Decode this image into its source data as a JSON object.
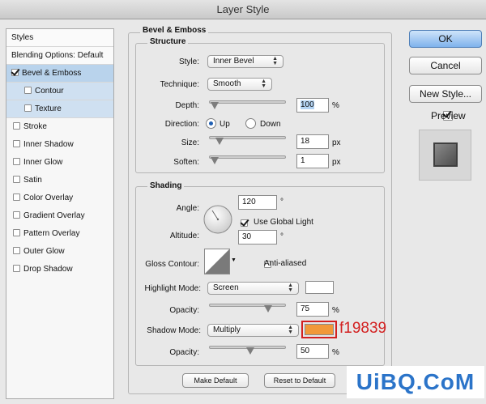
{
  "window": {
    "title": "Layer Style"
  },
  "styles_list": {
    "header": "Styles",
    "blending": "Blending Options: Default",
    "items": [
      {
        "label": "Bevel & Emboss",
        "checked": true
      },
      {
        "label": "Contour",
        "checked": false
      },
      {
        "label": "Texture",
        "checked": false
      },
      {
        "label": "Stroke",
        "checked": false
      },
      {
        "label": "Inner Shadow",
        "checked": false
      },
      {
        "label": "Inner Glow",
        "checked": false
      },
      {
        "label": "Satin",
        "checked": false
      },
      {
        "label": "Color Overlay",
        "checked": false
      },
      {
        "label": "Gradient Overlay",
        "checked": false
      },
      {
        "label": "Pattern Overlay",
        "checked": false
      },
      {
        "label": "Outer Glow",
        "checked": false
      },
      {
        "label": "Drop Shadow",
        "checked": false
      }
    ]
  },
  "bevel": {
    "title": "Bevel & Emboss",
    "structure": {
      "title": "Structure",
      "style_label": "Style:",
      "style_value": "Inner Bevel",
      "technique_label": "Technique:",
      "technique_value": "Smooth",
      "depth_label": "Depth:",
      "depth_value": "100",
      "depth_unit": "%",
      "depth_level": 0.0,
      "direction_label": "Direction:",
      "dir_up": "Up",
      "dir_down": "Down",
      "direction": "Up",
      "size_label": "Size:",
      "size_value": "18",
      "size_unit": "px",
      "size_level": 0.07,
      "soften_label": "Soften:",
      "soften_value": "1",
      "soften_unit": "px",
      "soften_level": 0.0
    },
    "shading": {
      "title": "Shading",
      "angle_label": "Angle:",
      "angle_value": "120",
      "angle_unit": "°",
      "use_global_light": "Use Global Light",
      "global_light_checked": true,
      "altitude_label": "Altitude:",
      "altitude_value": "30",
      "altitude_unit": "°",
      "gloss_label": "Gloss Contour:",
      "anti_aliased": "Anti-aliased",
      "anti_aliased_checked": false,
      "highlight_label": "Highlight Mode:",
      "highlight_value": "Screen",
      "highlight_color": "#ffffff",
      "hl_opacity_label": "Opacity:",
      "hl_opacity_value": "75",
      "hl_opacity_unit": "%",
      "hl_opacity_level": 0.75,
      "shadow_label": "Shadow Mode:",
      "shadow_value": "Multiply",
      "shadow_color": "#f19839",
      "sh_opacity_label": "Opacity:",
      "sh_opacity_value": "50",
      "sh_opacity_unit": "%",
      "sh_opacity_level": 0.5
    },
    "make_default": "Make Default",
    "reset_default": "Reset to Default"
  },
  "annotation": {
    "text": "f19839",
    "color": "#d32020"
  },
  "buttons": {
    "ok": "OK",
    "cancel": "Cancel",
    "new_style": "New Style...",
    "preview": "Preview",
    "preview_checked": true
  },
  "watermark": "UiBQ.CoM"
}
